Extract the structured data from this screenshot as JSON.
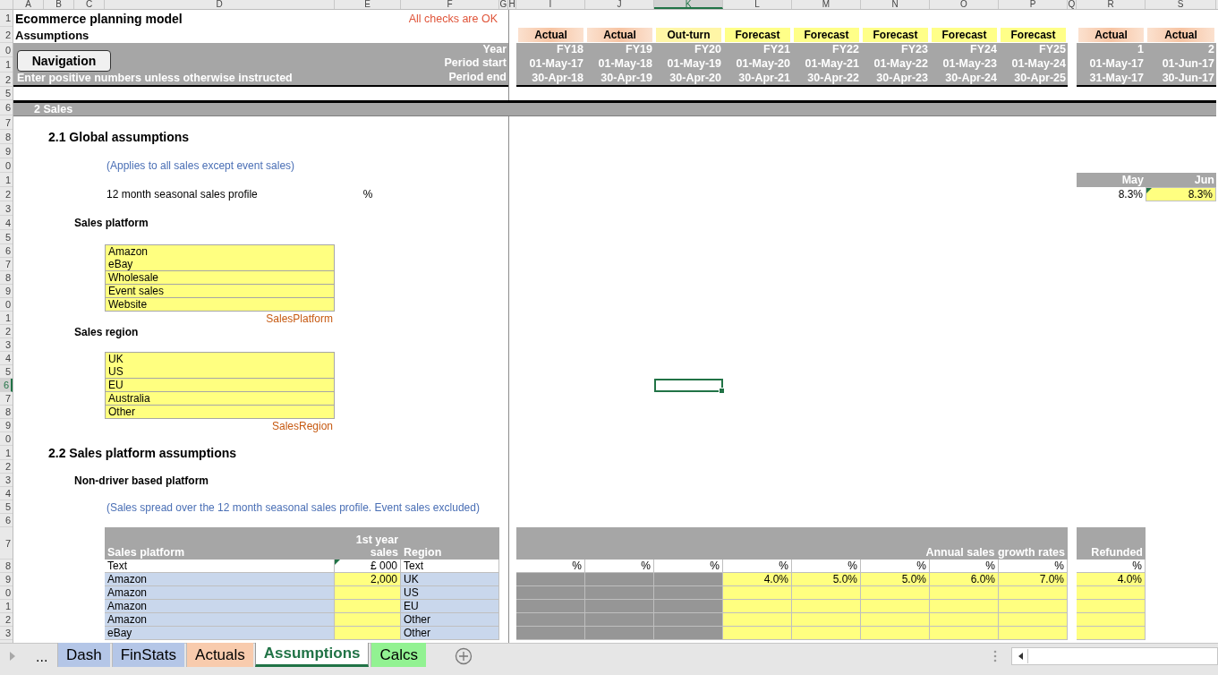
{
  "column_headers": [
    {
      "label": "A",
      "selected": false
    },
    {
      "label": "B",
      "selected": false
    },
    {
      "label": "C",
      "selected": false
    },
    {
      "label": "D",
      "selected": false
    },
    {
      "label": "E",
      "selected": false
    },
    {
      "label": "F",
      "selected": false
    },
    {
      "label": "G",
      "selected": false
    },
    {
      "label": "H",
      "selected": false
    },
    {
      "label": "I",
      "selected": false
    },
    {
      "label": "J",
      "selected": false
    },
    {
      "label": "K",
      "selected": true
    },
    {
      "label": "L",
      "selected": false
    },
    {
      "label": "M",
      "selected": false
    },
    {
      "label": "N",
      "selected": false
    },
    {
      "label": "O",
      "selected": false
    },
    {
      "label": "P",
      "selected": false
    },
    {
      "label": "Q",
      "selected": false
    },
    {
      "label": "R",
      "selected": false
    },
    {
      "label": "S",
      "selected": false
    }
  ],
  "row_headers": [
    {
      "label": "1",
      "selected": false
    },
    {
      "label": "2",
      "selected": false
    },
    {
      "label": "0",
      "selected": false
    },
    {
      "label": "1",
      "selected": false
    },
    {
      "label": "2",
      "selected": false
    },
    {
      "label": "5",
      "selected": false
    },
    {
      "label": "6",
      "selected": false
    },
    {
      "label": "7",
      "selected": false
    },
    {
      "label": "8",
      "selected": false
    },
    {
      "label": "9",
      "selected": false
    },
    {
      "label": "0",
      "selected": false
    },
    {
      "label": "1",
      "selected": false
    },
    {
      "label": "2",
      "selected": false
    },
    {
      "label": "3",
      "selected": false
    },
    {
      "label": "4",
      "selected": false
    },
    {
      "label": "5",
      "selected": false
    },
    {
      "label": "6",
      "selected": false
    },
    {
      "label": "7",
      "selected": false
    },
    {
      "label": "8",
      "selected": false
    },
    {
      "label": "9",
      "selected": false
    },
    {
      "label": "0",
      "selected": false
    },
    {
      "label": "1",
      "selected": false
    },
    {
      "label": "2",
      "selected": false
    },
    {
      "label": "3",
      "selected": false
    },
    {
      "label": "4",
      "selected": false
    },
    {
      "label": "5",
      "selected": false
    },
    {
      "label": "6",
      "selected": true
    },
    {
      "label": "7",
      "selected": false
    },
    {
      "label": "8",
      "selected": false
    },
    {
      "label": "9",
      "selected": false
    },
    {
      "label": "0",
      "selected": false
    },
    {
      "label": "1",
      "selected": false
    },
    {
      "label": "2",
      "selected": false
    },
    {
      "label": "3",
      "selected": false
    },
    {
      "label": "4",
      "selected": false
    },
    {
      "label": "5",
      "selected": false
    },
    {
      "label": "6",
      "selected": false
    },
    {
      "label": "7",
      "selected": false
    },
    {
      "label": "8",
      "selected": false
    },
    {
      "label": "9",
      "selected": false
    },
    {
      "label": "0",
      "selected": false
    },
    {
      "label": "1",
      "selected": false
    },
    {
      "label": "2",
      "selected": false
    },
    {
      "label": "3",
      "selected": false
    }
  ],
  "title": "Ecommerce planning model",
  "subtitle": "Assumptions",
  "check_status": "All checks are OK",
  "navigation_button": "Navigation",
  "instruction": "Enter positive numbers unless otherwise instructed",
  "timeline_labels": [
    "Year",
    "Period start",
    "Period end"
  ],
  "periods": [
    {
      "type": "Actual",
      "kind": "actual",
      "year": "FY18",
      "start": "01-May-17",
      "end": "30-Apr-18"
    },
    {
      "type": "Actual",
      "kind": "actual",
      "year": "FY19",
      "start": "01-May-18",
      "end": "30-Apr-19"
    },
    {
      "type": "Out-turn",
      "kind": "outturn",
      "year": "FY20",
      "start": "01-May-19",
      "end": "30-Apr-20"
    },
    {
      "type": "Forecast",
      "kind": "forecast",
      "year": "FY21",
      "start": "01-May-20",
      "end": "30-Apr-21"
    },
    {
      "type": "Forecast",
      "kind": "forecast",
      "year": "FY22",
      "start": "01-May-21",
      "end": "30-Apr-22"
    },
    {
      "type": "Forecast",
      "kind": "forecast",
      "year": "FY23",
      "start": "01-May-22",
      "end": "30-Apr-23"
    },
    {
      "type": "Forecast",
      "kind": "forecast",
      "year": "FY24",
      "start": "01-May-23",
      "end": "30-Apr-24"
    },
    {
      "type": "Forecast",
      "kind": "forecast",
      "year": "FY25",
      "start": "01-May-24",
      "end": "30-Apr-25"
    }
  ],
  "monthly_periods": [
    {
      "type": "Actual",
      "kind": "actual",
      "year": "1",
      "start": "01-May-17",
      "end": "31-May-17"
    },
    {
      "type": "Actual",
      "kind": "actual",
      "year": "2",
      "start": "01-Jun-17",
      "end": "30-Jun-17"
    }
  ],
  "section_title": "2 Sales",
  "global_assumptions": {
    "heading": "2.1  Global assumptions",
    "note": "(Applies to all sales except event sales)",
    "profile_label": "12 month seasonal sales profile",
    "profile_unit": "%",
    "months": [
      {
        "name": "May",
        "value": "8.3%",
        "input": false,
        "flagged": false
      },
      {
        "name": "Jun",
        "value": "8.3%",
        "input": true,
        "flagged": true
      }
    ]
  },
  "sales_platform": {
    "heading": "Sales platform",
    "items": [
      "Amazon",
      "eBay",
      "Wholesale",
      "Event sales",
      "Website"
    ],
    "range_name": "SalesPlatform"
  },
  "sales_region": {
    "heading": "Sales region",
    "items": [
      "UK",
      "US",
      "EU",
      "Australia",
      "Other"
    ],
    "range_name": "SalesRegion"
  },
  "platform_assumptions": {
    "heading": "2.2  Sales platform assumptions",
    "subheading": "Non-driver based platform",
    "note": "(Sales spread over the 12 month seasonal sales profile. Event sales excluded)",
    "table": {
      "columns": [
        "Sales platform",
        "1st year sales",
        "Region"
      ],
      "units": [
        {
          "text": "Text",
          "flagged": false
        },
        {
          "text": "£ 000",
          "flagged": true
        },
        {
          "text": "Text",
          "flagged": false
        }
      ],
      "growth_title": "Annual sales growth rates",
      "growth_unit": "%",
      "refund_title": "Refunded",
      "refund_unit": "%",
      "rows": [
        {
          "platform": "Amazon",
          "sales": "2,000",
          "region": "UK",
          "growth": [
            "4.0%",
            "5.0%",
            "5.0%",
            "6.0%",
            "7.0%"
          ],
          "refund": "4.0%"
        },
        {
          "platform": "Amazon",
          "region": "US"
        },
        {
          "platform": "Amazon",
          "region": "EU"
        },
        {
          "platform": "Amazon",
          "region": "Other"
        },
        {
          "platform": "eBay",
          "region": "Other"
        }
      ]
    }
  },
  "tab_overflow": "...",
  "sheet_tabs": [
    {
      "label": "Dash",
      "color": "#b4c6e7",
      "selected": false
    },
    {
      "label": "FinStats",
      "color": "#b4c6e7",
      "selected": false
    },
    {
      "label": "Actuals",
      "color": "#f8cbad",
      "selected": false
    },
    {
      "label": "Assumptions",
      "color": "#217346",
      "selected": true
    },
    {
      "label": "Calcs",
      "color": "#92f292",
      "selected": false
    }
  ]
}
